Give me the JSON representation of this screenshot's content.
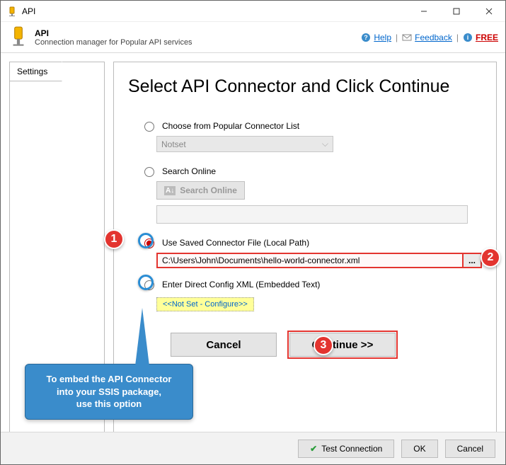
{
  "window": {
    "title": "API"
  },
  "header": {
    "app_name": "API",
    "app_desc": "Connection manager for Popular API services",
    "help": "Help",
    "feedback": "Feedback",
    "free": "FREE"
  },
  "sidebar": {
    "tab": "Settings"
  },
  "main": {
    "heading": "Select API Connector and Click Continue",
    "opt_popular": "Choose from Popular Connector List",
    "popular_value": "Notset",
    "opt_search": "Search Online",
    "search_btn": "Search Online",
    "opt_saved": "Use Saved Connector File (Local Path)",
    "saved_path": "C:\\Users\\John\\Documents\\hello-world-connector.xml",
    "browse": "...",
    "opt_xml": "Enter Direct Config XML (Embedded Text)",
    "xml_notset": "<<Not Set - Configure>>",
    "cancel": "Cancel",
    "continue": "Continue >>"
  },
  "badges": {
    "b1": "1",
    "b2": "2",
    "b3": "3"
  },
  "callout": {
    "line1": "To embed the API Connector",
    "line2": "into your SSIS package,",
    "line3": "use this option"
  },
  "footer": {
    "test": "Test Connection",
    "ok": "OK",
    "cancel": "Cancel"
  }
}
